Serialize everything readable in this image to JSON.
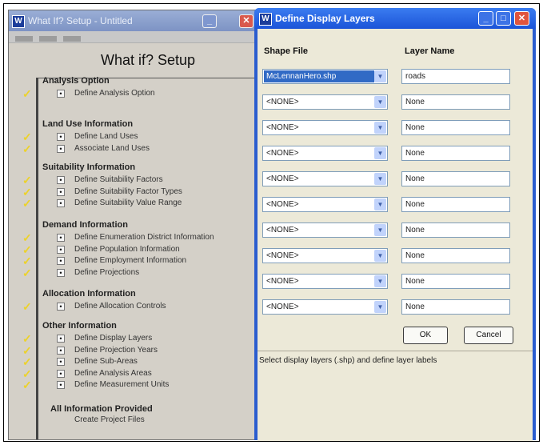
{
  "setup_window": {
    "title": "What If? Setup - Untitled",
    "heading": "What if? Setup",
    "sections": [
      {
        "title": "Analysis Option",
        "items": [
          {
            "label": "Define Analysis Option",
            "done": true
          }
        ]
      },
      {
        "title": "Land Use Information",
        "items": [
          {
            "label": "Define Land Uses",
            "done": true
          },
          {
            "label": "Associate Land Uses",
            "done": true
          }
        ]
      },
      {
        "title": "Suitability Information",
        "items": [
          {
            "label": "Define Suitability Factors",
            "done": true
          },
          {
            "label": "Define Suitability Factor Types",
            "done": true
          },
          {
            "label": "Define Suitability Value Range",
            "done": true
          }
        ]
      },
      {
        "title": "Demand Information",
        "items": [
          {
            "label": "Define Enumeration District Information",
            "done": true
          },
          {
            "label": "Define Population Information",
            "done": true
          },
          {
            "label": "Define Employment Information",
            "done": true
          },
          {
            "label": "Define Projections",
            "done": true
          }
        ]
      },
      {
        "title": "Allocation Information",
        "items": [
          {
            "label": "Define Allocation Controls",
            "done": true
          }
        ]
      },
      {
        "title": "Other Information",
        "items": [
          {
            "label": "Define Display Layers",
            "done": true
          },
          {
            "label": "Define Projection Years",
            "done": true
          },
          {
            "label": "Define Sub-Areas",
            "done": true
          },
          {
            "label": "Define Analysis Areas",
            "done": true
          },
          {
            "label": "Define Measurement Units",
            "done": true
          }
        ]
      }
    ],
    "footer_title": "All Information Provided",
    "footer_action": "Create Project Files"
  },
  "dialog": {
    "title": "Define Display Layers",
    "col_shape": "Shape File",
    "col_layer": "Layer Name",
    "rows": [
      {
        "shape": "McLennanHero.shp",
        "layer": "roads",
        "selected": true
      },
      {
        "shape": "<NONE>",
        "layer": "None"
      },
      {
        "shape": "<NONE>",
        "layer": "None"
      },
      {
        "shape": "<NONE>",
        "layer": "None"
      },
      {
        "shape": "<NONE>",
        "layer": "None"
      },
      {
        "shape": "<NONE>",
        "layer": "None"
      },
      {
        "shape": "<NONE>",
        "layer": "None"
      },
      {
        "shape": "<NONE>",
        "layer": "None"
      },
      {
        "shape": "<NONE>",
        "layer": "None"
      },
      {
        "shape": "<NONE>",
        "layer": "None"
      }
    ],
    "ok_label": "OK",
    "cancel_label": "Cancel",
    "status": "Select display layers (.shp) and define layer labels"
  },
  "icons": {
    "app": "w-app-icon",
    "minimize": "minimize-icon",
    "maximize": "maximize-icon",
    "close": "close-icon",
    "dropdown": "chevron-down-icon",
    "check": "checkmark-icon"
  },
  "colors": {
    "check": "#ecd22a",
    "titlebar_active": "#2a5ccf",
    "titlebar_inactive": "#8ea2cf",
    "close_button": "#e0553e",
    "selection": "#316ac5"
  }
}
